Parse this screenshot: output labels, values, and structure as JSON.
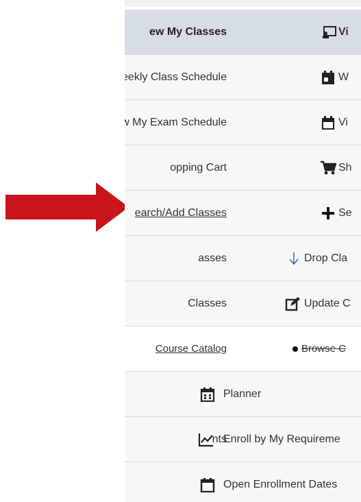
{
  "arrow": {
    "color": "#c8141b",
    "icon": "red-arrow-right"
  },
  "menu": {
    "rows": [
      {
        "left": "ew My Classes",
        "right": "Vi",
        "icon": "monitor-classroom-icon"
      },
      {
        "left": "eekly Class Schedule",
        "right": "W",
        "icon": "calendar-week-icon"
      },
      {
        "left": "ew My Exam Schedule",
        "right": "Vi",
        "icon": "calendar-icon"
      },
      {
        "left": "opping Cart",
        "right": "Sh",
        "icon": "cart-icon"
      },
      {
        "left": "earch/Add Classes",
        "right": "Se",
        "icon": "plus-icon"
      },
      {
        "left": "asses",
        "right": "Drop Cla",
        "icon": "arrow-down-icon"
      },
      {
        "left": "Classes",
        "right": "Update C",
        "icon": "edit-icon"
      },
      {
        "left": "Course Catalog",
        "right": "Browse C",
        "icon": "book-icon"
      },
      {
        "left": "",
        "right": "Planner",
        "icon": "planner-icon"
      },
      {
        "left": "nts",
        "right": "Enroll by My Requireme",
        "icon": "chart-line-icon"
      },
      {
        "left": "",
        "right": "Open Enrollment Dates",
        "icon": "calendar-outline-icon"
      }
    ]
  },
  "colors": {
    "active_bg": "#d7dde6",
    "row_bg": "#f7f7f7",
    "divider": "#d9d9d9",
    "arrow": "#c8141b"
  }
}
